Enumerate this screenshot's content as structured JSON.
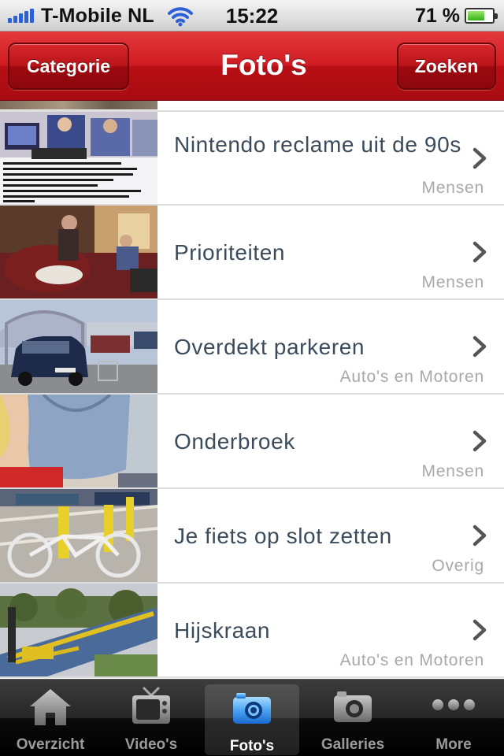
{
  "status": {
    "carrier": "T-Mobile NL",
    "time": "15:22",
    "battery": "71 %",
    "battery_level": 0.71,
    "signal_bars": 5
  },
  "navbar": {
    "title": "Foto's",
    "left_button": "Categorie",
    "right_button": "Zoeken"
  },
  "colors": {
    "nav_red": "#d01c22",
    "title_text": "#3b4b5a",
    "category_text": "#a8a8a8",
    "tab_selected_icon": "#4aa3f0"
  },
  "items": [
    {
      "title": "Nintendo reclame uit de 90s",
      "category": "Mensen"
    },
    {
      "title": "Prioriteiten",
      "category": "Mensen"
    },
    {
      "title": "Overdekt parkeren",
      "category": "Auto's en Motoren"
    },
    {
      "title": "Onderbroek",
      "category": "Mensen"
    },
    {
      "title": "Je fiets op slot zetten",
      "category": "Overig"
    },
    {
      "title": "Hijskraan",
      "category": "Auto's en Motoren"
    }
  ],
  "tabs": [
    {
      "label": "Overzicht",
      "icon": "house-icon"
    },
    {
      "label": "Video's",
      "icon": "tv-icon"
    },
    {
      "label": "Foto's",
      "icon": "camera-icon",
      "selected": true
    },
    {
      "label": "Galleries",
      "icon": "camera-icon"
    },
    {
      "label": "More",
      "icon": "more-dots-icon"
    }
  ]
}
